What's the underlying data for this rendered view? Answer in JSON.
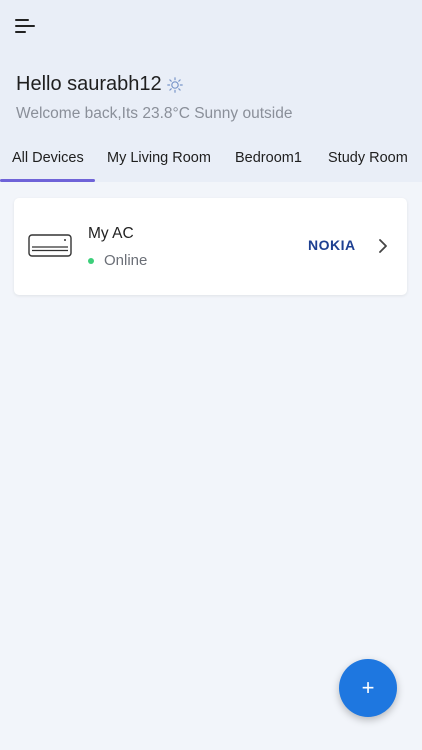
{
  "header": {
    "greeting": "Hello saurabh12",
    "weather_message": "Welcome back,Its 23.8°C Sunny outside",
    "weather_icon": "sun-icon"
  },
  "tabs": [
    {
      "label": "All Devices",
      "selected": true
    },
    {
      "label": "My Living Room",
      "selected": false
    },
    {
      "label": "Bedroom1",
      "selected": false
    },
    {
      "label": "Study Room",
      "selected": false
    }
  ],
  "devices": [
    {
      "name": "My AC",
      "status": "Online",
      "brand": "NOKIA",
      "icon": "air-conditioner-icon"
    }
  ],
  "fab": {
    "label": "+"
  },
  "colors": {
    "accent": "#6f63d8",
    "fab": "#1e77e0",
    "online": "#3ccf7a",
    "brand": "#1d3f91"
  }
}
